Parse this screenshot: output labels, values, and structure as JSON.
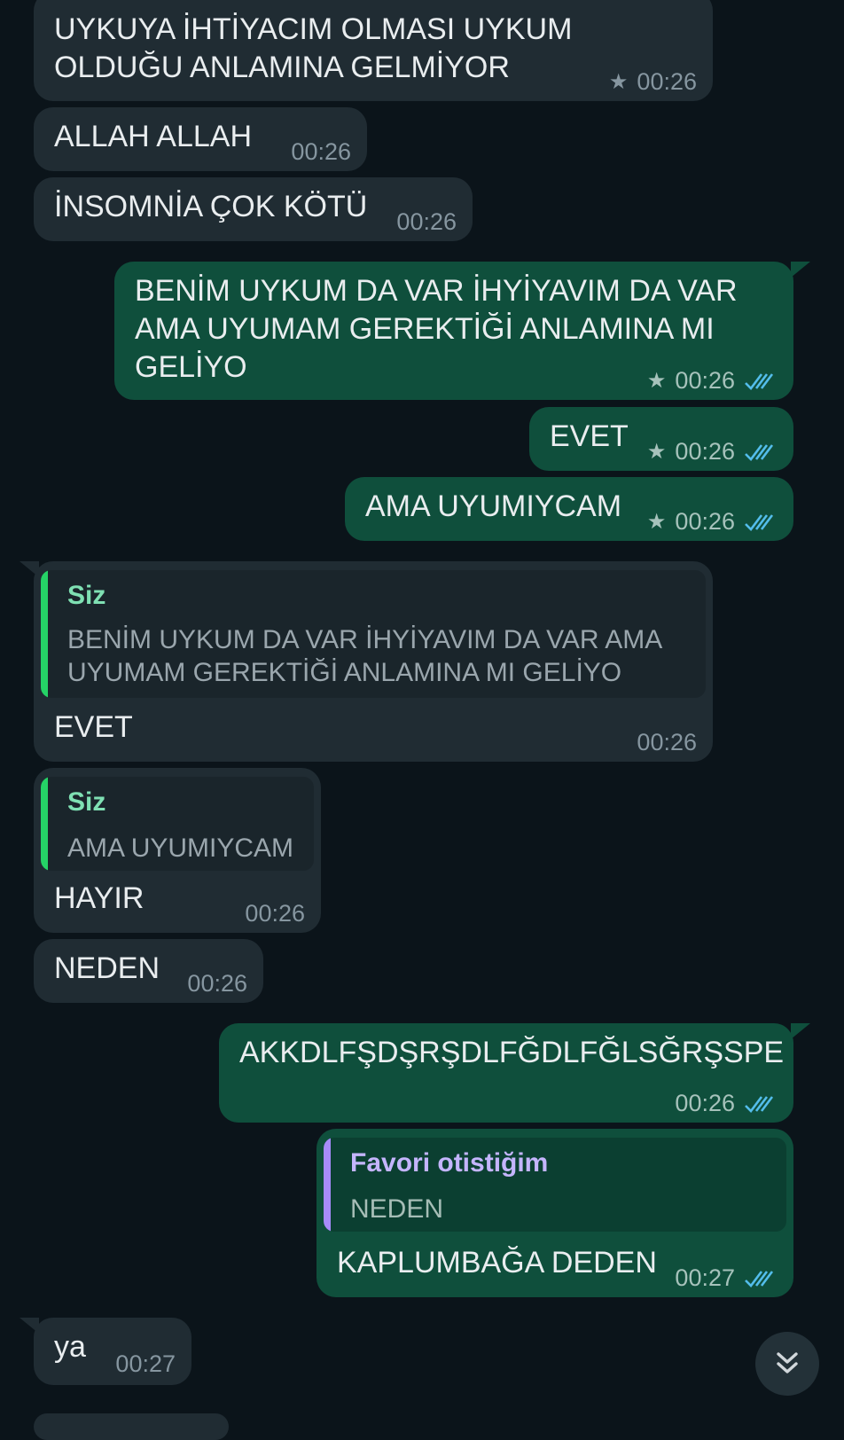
{
  "messages": [
    {
      "text": "UYKUYA İHTİYACIM OLMASI UYKUM\nOLDUĞU ANLAMINA GELMİYOR",
      "time": "00:26"
    },
    {
      "text": "ALLAH ALLAH",
      "time": "00:26"
    },
    {
      "text": "İNSOMNİA ÇOK KÖTÜ",
      "time": "00:26"
    },
    {
      "text": "BENİM UYKUM DA VAR İHYİYAVIM DA VAR\nAMA UYUMAM GEREKTİĞİ ANLAMINA MI\nGELİYO",
      "time": "00:26"
    },
    {
      "text": "EVET",
      "time": "00:26"
    },
    {
      "text": "AMA UYUMIYCAM",
      "time": "00:26"
    },
    {
      "quote_author": "Siz",
      "quote_text": "BENİM UYKUM DA VAR İHYİYAVIM DA VAR AMA\nUYUMAM GEREKTİĞİ ANLAMINA MI GELİYO",
      "text": "EVET",
      "time": "00:26"
    },
    {
      "quote_author": "Siz",
      "quote_text": "AMA UYUMIYCAM",
      "text": "HAYIR",
      "time": "00:26"
    },
    {
      "text": "NEDEN",
      "time": "00:26"
    },
    {
      "text": "AKKDLFŞDŞRŞDLFĞDLFĞLSĞRŞSPE",
      "time": "00:26"
    },
    {
      "quote_author": "Favori otistiğim",
      "quote_text": "NEDEN",
      "text": "KAPLUMBAĞA DEDEN",
      "time": "00:27"
    },
    {
      "text": "ya",
      "time": "00:27"
    }
  ],
  "icons": {
    "star": "star-icon",
    "read": "double-check-icon",
    "scroll": "scroll-down-icon"
  },
  "colors": {
    "background": "#0b141a",
    "incoming": "#202c33",
    "outgoing": "#0f4f3c",
    "read_ticks": "#53bdeb",
    "quote_self": "#25d366",
    "quote_other": "#a78bfa"
  }
}
